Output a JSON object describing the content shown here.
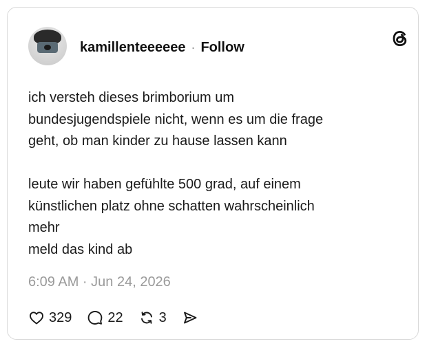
{
  "post": {
    "username": "kamillenteeeeee",
    "separator": "·",
    "follow_label": "Follow",
    "text": "ich versteh dieses brimborium um\nbundesjugendspiele nicht, wenn es um die frage\ngeht, ob man kinder zu hause lassen kann\n\nleute wir haben gefühlte 500 grad, auf einem\nkünstlichen platz ohne schatten wahrscheinlich\nmehr\nmeld das kind ab",
    "timestamp": "6:09 AM · Jun 24, 2026"
  },
  "actions": {
    "likes": "329",
    "replies": "22",
    "reposts": "3"
  },
  "icons": {
    "logo": "threads-logo-icon",
    "like": "heart-icon",
    "reply": "speech-bubble-icon",
    "repost": "repost-icon",
    "share": "send-icon"
  },
  "colors": {
    "text": "#1a1a1a",
    "muted": "#9a9a9a",
    "border": "#d9d9d9"
  }
}
